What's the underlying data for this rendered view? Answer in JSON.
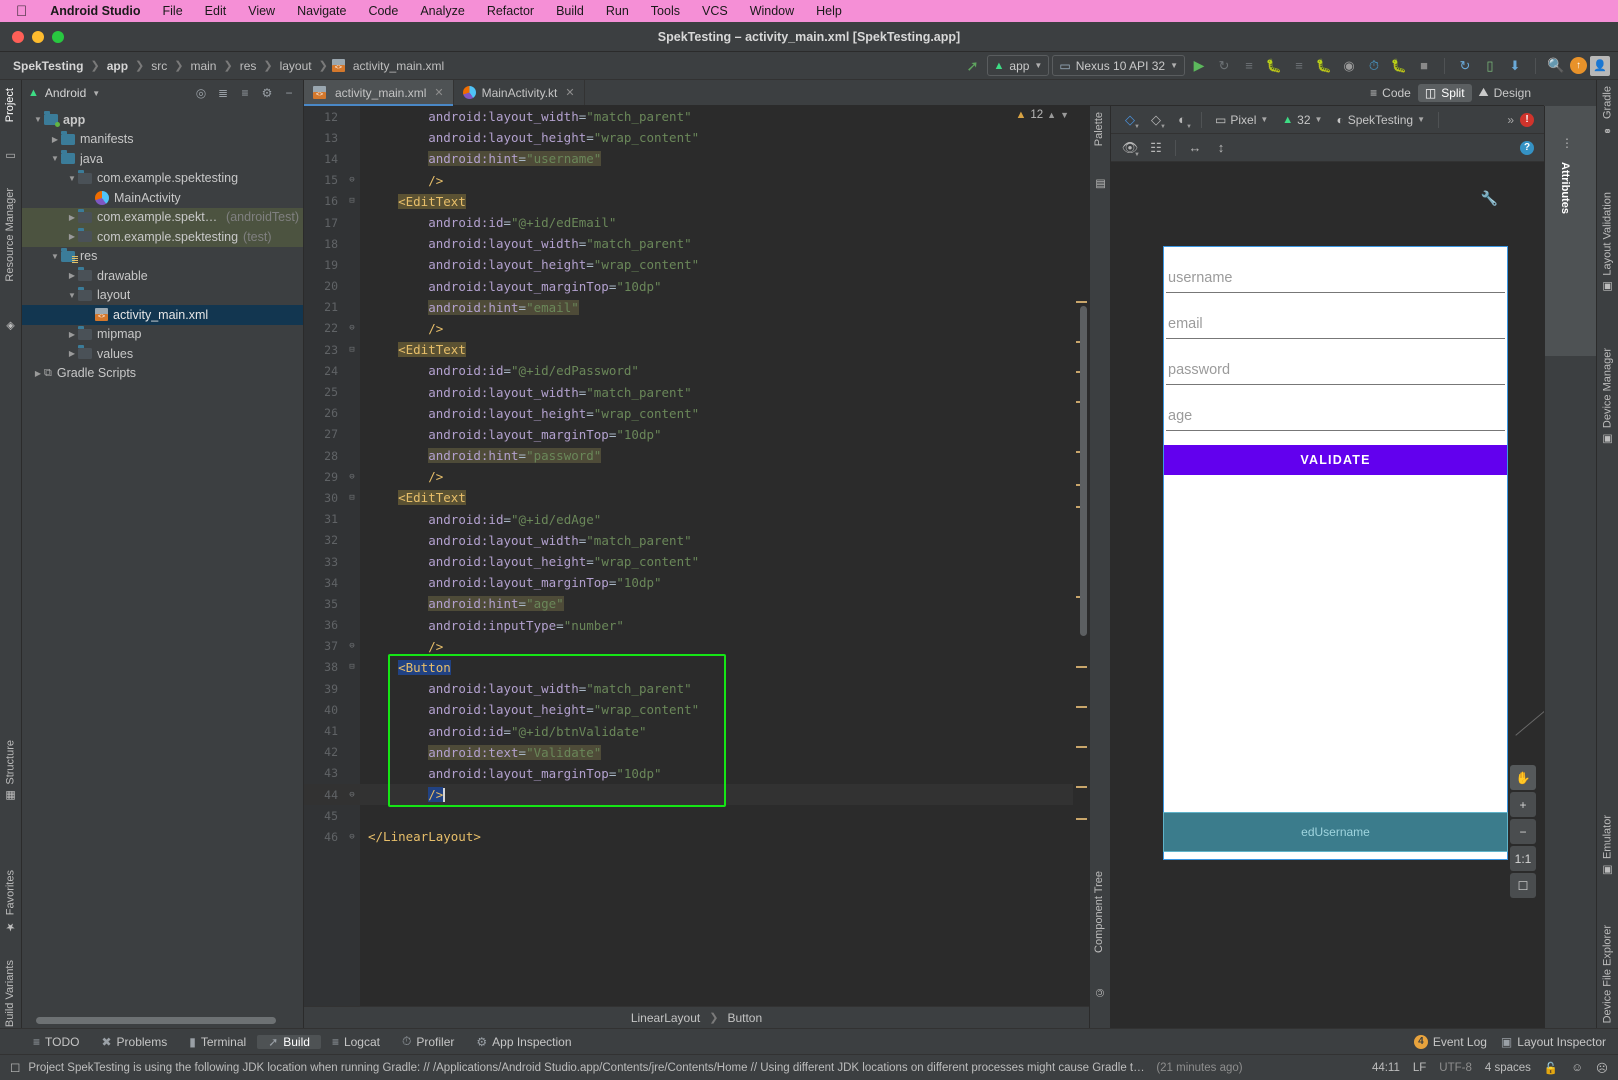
{
  "mac_menu": {
    "apple": "apple-logo",
    "items": [
      "Android Studio",
      "File",
      "Edit",
      "View",
      "Navigate",
      "Code",
      "Analyze",
      "Refactor",
      "Build",
      "Run",
      "Tools",
      "VCS",
      "Window",
      "Help"
    ]
  },
  "window": {
    "title": "SpekTesting – activity_main.xml [SpekTesting.app]"
  },
  "breadcrumb": {
    "items": [
      "SpekTesting",
      "app",
      "src",
      "main",
      "res",
      "layout"
    ],
    "file": "activity_main.xml"
  },
  "toolbar": {
    "run_config": "app",
    "device": "Nexus 10 API 32",
    "icons": [
      "hammer-icon",
      "run-icon",
      "apply-changes-icon",
      "apply-code-changes-icon",
      "debug-icon",
      "stop-icon",
      "profile-icon",
      "attach-debugger-icon",
      "sync-gradle-icon",
      "avd-manager-icon",
      "sdk-manager-icon",
      "search-icon",
      "update-icon",
      "account-icon"
    ]
  },
  "project": {
    "title": "Android",
    "tree": [
      {
        "label": "app",
        "indent": 0,
        "arrow": "down",
        "icon": "folder-module",
        "bold": true
      },
      {
        "label": "manifests",
        "indent": 1,
        "arrow": "right",
        "icon": "folder"
      },
      {
        "label": "java",
        "indent": 1,
        "arrow": "down",
        "icon": "folder"
      },
      {
        "label": "com.example.spektesting",
        "indent": 2,
        "arrow": "down",
        "icon": "package"
      },
      {
        "label": "MainActivity",
        "indent": 3,
        "arrow": "none",
        "icon": "kotlin-file"
      },
      {
        "label": "com.example.spektesting",
        "suffix": "(androidTest)",
        "indent": 2,
        "arrow": "right",
        "icon": "package",
        "highlight": true
      },
      {
        "label": "com.example.spektesting",
        "suffix": "(test)",
        "indent": 2,
        "arrow": "right",
        "icon": "package",
        "highlight": true
      },
      {
        "label": "res",
        "indent": 1,
        "arrow": "down",
        "icon": "folder-res"
      },
      {
        "label": "drawable",
        "indent": 2,
        "arrow": "right",
        "icon": "package"
      },
      {
        "label": "layout",
        "indent": 2,
        "arrow": "down",
        "icon": "package"
      },
      {
        "label": "activity_main.xml",
        "indent": 3,
        "arrow": "none",
        "icon": "xml-file",
        "selected": true
      },
      {
        "label": "mipmap",
        "indent": 2,
        "arrow": "right",
        "icon": "package"
      },
      {
        "label": "values",
        "indent": 2,
        "arrow": "right",
        "icon": "package"
      },
      {
        "label": "Gradle Scripts",
        "indent": 0,
        "arrow": "right",
        "icon": "gradle"
      }
    ]
  },
  "left_rail": [
    "Project",
    "Resource Manager"
  ],
  "left_rail_bottom": [
    "Structure",
    "Favorites",
    "Build Variants"
  ],
  "right_rail": [
    "Gradle",
    "Layout Validation",
    "Device Manager",
    "Emulator",
    "Device File Explorer"
  ],
  "attributes_panel": {
    "label": "Attributes"
  },
  "editor_tabs": [
    {
      "label": "activity_main.xml",
      "icon": "xml-file",
      "active": true
    },
    {
      "label": "MainActivity.kt",
      "icon": "kotlin-file",
      "active": false
    }
  ],
  "view_modes": [
    {
      "label": "Code",
      "icon": "code-icon",
      "selected": false
    },
    {
      "label": "Split",
      "icon": "split-icon",
      "selected": true
    },
    {
      "label": "Design",
      "icon": "design-icon",
      "selected": false
    }
  ],
  "inspection": {
    "count": "12",
    "icon": "warning-triangle"
  },
  "code_lines": [
    {
      "n": 12,
      "fold": "",
      "indent": 8,
      "tokens": [
        {
          "t": "attr",
          "v": "android:layout_width"
        },
        {
          "t": "eq",
          "v": "="
        },
        {
          "t": "val",
          "v": "\"match_parent\""
        }
      ]
    },
    {
      "n": 13,
      "fold": "",
      "indent": 8,
      "tokens": [
        {
          "t": "attr",
          "v": "android:layout_height"
        },
        {
          "t": "eq",
          "v": "="
        },
        {
          "t": "val",
          "v": "\"wrap_content\""
        }
      ]
    },
    {
      "n": 14,
      "fold": "",
      "indent": 8,
      "hl": true,
      "tokens": [
        {
          "t": "attr",
          "v": "android:hint"
        },
        {
          "t": "eq",
          "v": "="
        },
        {
          "t": "val",
          "v": "\"username\""
        }
      ]
    },
    {
      "n": 15,
      "fold": "end",
      "indent": 8,
      "tokens": [
        {
          "t": "brk",
          "v": "/>"
        }
      ]
    },
    {
      "n": 16,
      "fold": "start",
      "indent": 4,
      "hltag": true,
      "tokens": [
        {
          "t": "tag",
          "v": "<EditText"
        }
      ]
    },
    {
      "n": 17,
      "fold": "",
      "indent": 8,
      "tokens": [
        {
          "t": "attr",
          "v": "android:id"
        },
        {
          "t": "eq",
          "v": "="
        },
        {
          "t": "val",
          "v": "\"@+id/edEmail\""
        }
      ]
    },
    {
      "n": 18,
      "fold": "",
      "indent": 8,
      "tokens": [
        {
          "t": "attr",
          "v": "android:layout_width"
        },
        {
          "t": "eq",
          "v": "="
        },
        {
          "t": "val",
          "v": "\"match_parent\""
        }
      ]
    },
    {
      "n": 19,
      "fold": "",
      "indent": 8,
      "tokens": [
        {
          "t": "attr",
          "v": "android:layout_height"
        },
        {
          "t": "eq",
          "v": "="
        },
        {
          "t": "val",
          "v": "\"wrap_content\""
        }
      ]
    },
    {
      "n": 20,
      "fold": "",
      "indent": 8,
      "tokens": [
        {
          "t": "attr",
          "v": "android:layout_marginTop"
        },
        {
          "t": "eq",
          "v": "="
        },
        {
          "t": "val",
          "v": "\"10dp\""
        }
      ]
    },
    {
      "n": 21,
      "fold": "",
      "indent": 8,
      "hl": true,
      "tokens": [
        {
          "t": "attr",
          "v": "android:hint"
        },
        {
          "t": "eq",
          "v": "="
        },
        {
          "t": "val",
          "v": "\"email\""
        }
      ]
    },
    {
      "n": 22,
      "fold": "end",
      "indent": 8,
      "tokens": [
        {
          "t": "brk",
          "v": "/>"
        }
      ]
    },
    {
      "n": 23,
      "fold": "start",
      "indent": 4,
      "hltag": true,
      "tokens": [
        {
          "t": "tag",
          "v": "<EditText"
        }
      ]
    },
    {
      "n": 24,
      "fold": "",
      "indent": 8,
      "tokens": [
        {
          "t": "attr",
          "v": "android:id"
        },
        {
          "t": "eq",
          "v": "="
        },
        {
          "t": "val",
          "v": "\"@+id/edPassword\""
        }
      ]
    },
    {
      "n": 25,
      "fold": "",
      "indent": 8,
      "tokens": [
        {
          "t": "attr",
          "v": "android:layout_width"
        },
        {
          "t": "eq",
          "v": "="
        },
        {
          "t": "val",
          "v": "\"match_parent\""
        }
      ]
    },
    {
      "n": 26,
      "fold": "",
      "indent": 8,
      "tokens": [
        {
          "t": "attr",
          "v": "android:layout_height"
        },
        {
          "t": "eq",
          "v": "="
        },
        {
          "t": "val",
          "v": "\"wrap_content\""
        }
      ]
    },
    {
      "n": 27,
      "fold": "",
      "indent": 8,
      "tokens": [
        {
          "t": "attr",
          "v": "android:layout_marginTop"
        },
        {
          "t": "eq",
          "v": "="
        },
        {
          "t": "val",
          "v": "\"10dp\""
        }
      ]
    },
    {
      "n": 28,
      "fold": "",
      "indent": 8,
      "hl": true,
      "tokens": [
        {
          "t": "attr",
          "v": "android:hint"
        },
        {
          "t": "eq",
          "v": "="
        },
        {
          "t": "val",
          "v": "\"password\""
        }
      ]
    },
    {
      "n": 29,
      "fold": "end",
      "indent": 8,
      "tokens": [
        {
          "t": "brk",
          "v": "/>"
        }
      ]
    },
    {
      "n": 30,
      "fold": "start",
      "indent": 4,
      "hltag": true,
      "tokens": [
        {
          "t": "tag",
          "v": "<EditText"
        }
      ]
    },
    {
      "n": 31,
      "fold": "",
      "indent": 8,
      "tokens": [
        {
          "t": "attr",
          "v": "android:id"
        },
        {
          "t": "eq",
          "v": "="
        },
        {
          "t": "val",
          "v": "\"@+id/edAge\""
        }
      ]
    },
    {
      "n": 32,
      "fold": "",
      "indent": 8,
      "tokens": [
        {
          "t": "attr",
          "v": "android:layout_width"
        },
        {
          "t": "eq",
          "v": "="
        },
        {
          "t": "val",
          "v": "\"match_parent\""
        }
      ]
    },
    {
      "n": 33,
      "fold": "",
      "indent": 8,
      "tokens": [
        {
          "t": "attr",
          "v": "android:layout_height"
        },
        {
          "t": "eq",
          "v": "="
        },
        {
          "t": "val",
          "v": "\"wrap_content\""
        }
      ]
    },
    {
      "n": 34,
      "fold": "",
      "indent": 8,
      "tokens": [
        {
          "t": "attr",
          "v": "android:layout_marginTop"
        },
        {
          "t": "eq",
          "v": "="
        },
        {
          "t": "val",
          "v": "\"10dp\""
        }
      ]
    },
    {
      "n": 35,
      "fold": "",
      "indent": 8,
      "hl": true,
      "tokens": [
        {
          "t": "attr",
          "v": "android:hint"
        },
        {
          "t": "eq",
          "v": "="
        },
        {
          "t": "val",
          "v": "\"age\""
        }
      ]
    },
    {
      "n": 36,
      "fold": "",
      "indent": 8,
      "tokens": [
        {
          "t": "attr",
          "v": "android:inputType"
        },
        {
          "t": "eq",
          "v": "="
        },
        {
          "t": "val",
          "v": "\"number\""
        }
      ]
    },
    {
      "n": 37,
      "fold": "end",
      "indent": 8,
      "tokens": [
        {
          "t": "brk",
          "v": "/>"
        }
      ]
    },
    {
      "n": 38,
      "fold": "start",
      "indent": 4,
      "seltag": true,
      "tokens": [
        {
          "t": "tag",
          "v": "<Button"
        }
      ]
    },
    {
      "n": 39,
      "fold": "",
      "indent": 8,
      "tokens": [
        {
          "t": "attr",
          "v": "android:layout_width"
        },
        {
          "t": "eq",
          "v": "="
        },
        {
          "t": "val",
          "v": "\"match_parent\""
        }
      ]
    },
    {
      "n": 40,
      "fold": "",
      "indent": 8,
      "tokens": [
        {
          "t": "attr",
          "v": "android:layout_height"
        },
        {
          "t": "eq",
          "v": "="
        },
        {
          "t": "val",
          "v": "\"wrap_content\""
        }
      ]
    },
    {
      "n": 41,
      "fold": "",
      "indent": 8,
      "tokens": [
        {
          "t": "attr",
          "v": "android:id"
        },
        {
          "t": "eq",
          "v": "="
        },
        {
          "t": "val",
          "v": "\"@+id/btnValidate\""
        }
      ]
    },
    {
      "n": 42,
      "fold": "",
      "indent": 8,
      "hl": true,
      "tokens": [
        {
          "t": "attr",
          "v": "android:text"
        },
        {
          "t": "eq",
          "v": "="
        },
        {
          "t": "val",
          "v": "\"Validate\""
        }
      ]
    },
    {
      "n": 43,
      "fold": "",
      "indent": 8,
      "tokens": [
        {
          "t": "attr",
          "v": "android:layout_marginTop"
        },
        {
          "t": "eq",
          "v": "="
        },
        {
          "t": "val",
          "v": "\"10dp\""
        }
      ]
    },
    {
      "n": 44,
      "fold": "end",
      "indent": 8,
      "cur": true,
      "caret": true,
      "seltag2": true,
      "tokens": [
        {
          "t": "brk",
          "v": "/>"
        }
      ]
    },
    {
      "n": 45,
      "fold": "",
      "indent": 0,
      "tokens": []
    },
    {
      "n": 46,
      "fold": "end",
      "indent": 0,
      "tokens": [
        {
          "t": "tag",
          "v": "</LinearLayout>"
        }
      ]
    }
  ],
  "design_toolbar": {
    "device": "Pixel",
    "api": "32",
    "theme": "SpekTesting",
    "overflow": "»",
    "icons": [
      "design-surface-icon",
      "orientation-icon",
      "night-mode-icon",
      "device-icon",
      "android-icon",
      "theme-icon"
    ]
  },
  "design_toolbar2": {
    "icons": [
      "eye-icon",
      "blueprint-columns-icon",
      "width-icon",
      "height-icon"
    ]
  },
  "preview": {
    "fields": [
      "username",
      "email",
      "password",
      "age"
    ],
    "button_label": "VALIDATE",
    "button_color": "#6200EE",
    "blueprint_label": "edUsername",
    "zoom_controls": [
      "pan-icon",
      "+",
      "−",
      "1:1",
      "fit-icon"
    ]
  },
  "editor_breadcrumb": {
    "parent": "LinearLayout",
    "child": "Button"
  },
  "bottom_tools": [
    {
      "label": "TODO",
      "icon": "todo-icon"
    },
    {
      "label": "Problems",
      "icon": "problems-icon"
    },
    {
      "label": "Terminal",
      "icon": "terminal-icon"
    },
    {
      "label": "Build",
      "icon": "build-hammer-icon",
      "active": true
    },
    {
      "label": "Logcat",
      "icon": "logcat-icon"
    },
    {
      "label": "Profiler",
      "icon": "profiler-icon"
    },
    {
      "label": "App Inspection",
      "icon": "app-inspection-icon"
    }
  ],
  "bottom_right": [
    {
      "label": "Event Log",
      "badge": "4",
      "icon": "event-log-icon"
    },
    {
      "label": "Layout Inspector",
      "icon": "layout-inspector-icon"
    }
  ],
  "status": {
    "message": "Project SpekTesting is using the following JDK location when running Gradle: // /Applications/Android Studio.app/Contents/jre/Contents/Home // Using different JDK locations on different processes might cause Gradle to spawn multipl...",
    "time": "(21 minutes ago)",
    "caret": "44:11",
    "line_sep": "LF",
    "encoding": "UTF-8",
    "indent": "4 spaces",
    "icons": [
      "lock-open-icon",
      "smiley-icon",
      "frowny-icon"
    ]
  }
}
